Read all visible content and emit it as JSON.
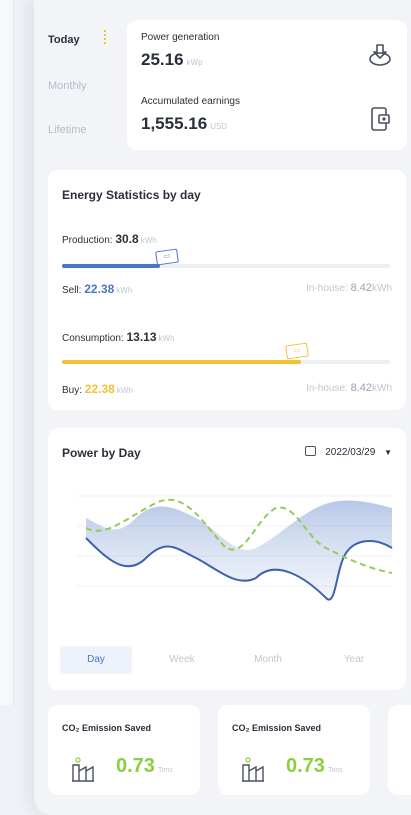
{
  "side_tabs": [
    "Today",
    "Monthly",
    "Lifetime"
  ],
  "summary": {
    "generation_label": "Power generation",
    "generation_value": "25.16",
    "generation_unit": "kWp",
    "earnings_label": "Accumulated earnings",
    "earnings_value": "1,555.16",
    "earnings_unit": "USD"
  },
  "energy": {
    "title": "Energy Statistics by day",
    "production_label": "Production:",
    "production_value": "30.8",
    "production_unit": "kWh",
    "production_fill": 0.3,
    "sell_label": "Sell:",
    "sell_value": "22.38",
    "sell_unit": "kWh",
    "sell_inhouse_label": "In-house:",
    "sell_inhouse_value": "8.42",
    "sell_inhouse_unit": "kWh",
    "consumption_label": "Consumption:",
    "consumption_value": "13.13",
    "consumption_unit": "kWh",
    "consumption_fill": 0.73,
    "buy_label": "Buy:",
    "buy_value": "22.38",
    "buy_unit": "kWh",
    "buy_inhouse_label": "In-house:",
    "buy_inhouse_value": "8.42",
    "buy_inhouse_unit": "kWh"
  },
  "power": {
    "title": "Power by Day",
    "date": "2022/03/29",
    "tabs": [
      "Day",
      "Week",
      "Month",
      "Year"
    ]
  },
  "co2_cards": [
    {
      "title": "CO₂ Emission Saved",
      "value": "0.73",
      "unit": "Tons"
    },
    {
      "title": "CO₂ Emission Saved",
      "value": "0.73",
      "unit": "Tons"
    }
  ],
  "colors": {
    "blue": "#4a76c8",
    "yellow": "#f2c233",
    "green": "#8ccf3e"
  }
}
